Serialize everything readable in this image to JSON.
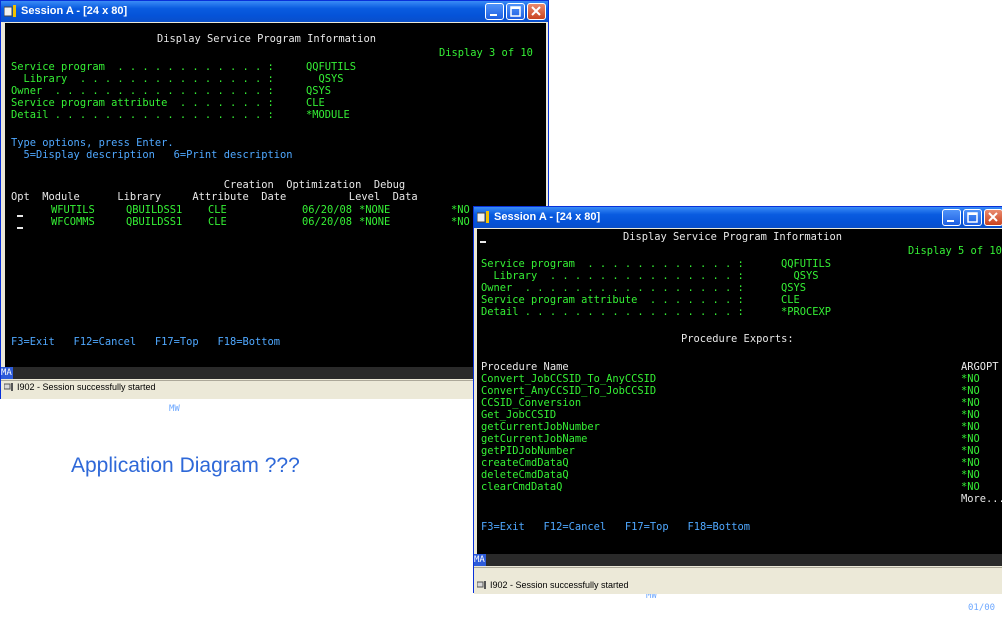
{
  "session1": {
    "title": "Session A - [24 x 80]",
    "screen": {
      "heading": "Display Service Program Information",
      "display_pos": "Display 3 of 10",
      "fields": [
        {
          "label": "Service program  . . . . . . . . . . . . :",
          "value": "QQFUTILS"
        },
        {
          "label": "  Library  . . . . . . . . . . . . . . . :",
          "value": "  QSYS"
        },
        {
          "label": "Owner  . . . . . . . . . . . . . . . . . :",
          "value": "QSYS"
        },
        {
          "label": "Service program attribute  . . . . . . . :",
          "value": "CLE"
        },
        {
          "label": "Detail . . . . . . . . . . . . . . . . . :",
          "value": "*MODULE"
        }
      ],
      "instructions": "Type options, press Enter.",
      "options": "  5=Display description   6=Print description",
      "header_line1": "                                  Creation  Optimization  Debug",
      "header_line2": "Opt  Module      Library     Attribute  Date          Level  Data",
      "rows": [
        {
          "module": "WFUTILS",
          "library": "QBUILDSS1",
          "attribute": "CLE",
          "date": "06/20/08",
          "level": "*NONE",
          "debug": "*NO"
        },
        {
          "module": "WFCOMMS",
          "library": "QBUILDSS1",
          "attribute": "CLE",
          "date": "06/20/08",
          "level": "*NONE",
          "debug": "*NO"
        }
      ],
      "fkeys": "F3=Exit   F12=Cancel   F17=Top   F18=Bottom"
    },
    "oia": {
      "ma": "MA",
      "mode": "a",
      "mw": "MW"
    },
    "status_text": "I902 - Session successfully started"
  },
  "session2": {
    "title": "Session A - [24 x 80]",
    "screen": {
      "heading": "Display Service Program Information",
      "display_pos": "Display 5 of 10",
      "fields": [
        {
          "label": "Service program  . . . . . . . . . . . . :",
          "value": "QQFUTILS"
        },
        {
          "label": "  Library  . . . . . . . . . . . . . . . :",
          "value": "  QSYS"
        },
        {
          "label": "Owner  . . . . . . . . . . . . . . . . . :",
          "value": "QSYS"
        },
        {
          "label": "Service program attribute  . . . . . . . :",
          "value": "CLE"
        },
        {
          "label": "Detail . . . . . . . . . . . . . . . . . :",
          "value": "*PROCEXP"
        }
      ],
      "section_title": "Procedure Exports:",
      "col_name": "Procedure Name",
      "col_argopt": "ARGOPT",
      "procedures": [
        {
          "name": "Convert_JobCCSID_To_AnyCCSID",
          "argopt": "*NO"
        },
        {
          "name": "Convert_AnyCCSID_To_JobCCSID",
          "argopt": "*NO"
        },
        {
          "name": "CCSID_Conversion",
          "argopt": "*NO"
        },
        {
          "name": "Get_JobCCSID",
          "argopt": "*NO"
        },
        {
          "name": "getCurrentJobNumber",
          "argopt": "*NO"
        },
        {
          "name": "getCurrentJobName",
          "argopt": "*NO"
        },
        {
          "name": "getPIDJobNumber",
          "argopt": "*NO"
        },
        {
          "name": "createCmdDataQ",
          "argopt": "*NO"
        },
        {
          "name": "deleteCmdDataQ",
          "argopt": "*NO"
        },
        {
          "name": "clearCmdDataQ",
          "argopt": "*NO"
        }
      ],
      "more": "More...",
      "fkeys": "F3=Exit   F12=Cancel   F17=Top   F18=Bottom"
    },
    "oia": {
      "ma": "MA",
      "mode": "a",
      "mw": "MW",
      "cursor_pos": "01/00"
    },
    "status_text": "I902 - Session successfully started"
  },
  "caption": "Application Diagram ???",
  "colors": {
    "terminal_green": "#35f035",
    "terminal_blue": "#4fa8ff",
    "xp_title": "#0553d8",
    "caption": "#2e68d8"
  }
}
